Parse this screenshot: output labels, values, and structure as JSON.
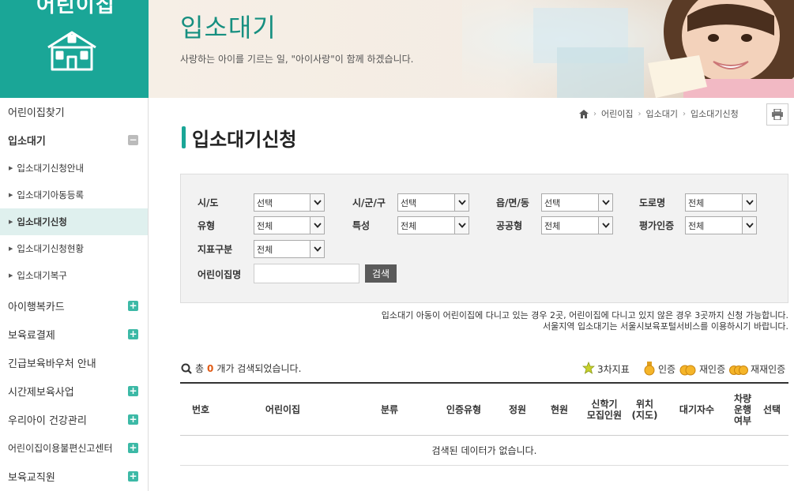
{
  "logo": {
    "text": "어린이집"
  },
  "banner": {
    "title": "입소대기",
    "subtitle": "사랑하는 아이를 기르는 일, \"아이사랑\"이 함께 하겠습니다."
  },
  "sidebar": {
    "items": [
      {
        "label": "어린이집찾기"
      },
      {
        "label": "입소대기"
      },
      {
        "label": "아이행복카드"
      },
      {
        "label": "보육료결제"
      },
      {
        "label": "긴급보육바우처 안내"
      },
      {
        "label": "시간제보육사업"
      },
      {
        "label": "우리아이 건강관리"
      },
      {
        "label": "어린이집이용불편신고센터"
      },
      {
        "label": "보육교직원"
      }
    ],
    "subitems": [
      {
        "label": "입소대기신청안내"
      },
      {
        "label": "입소대기아동등록"
      },
      {
        "label": "입소대기신청"
      },
      {
        "label": "입소대기신청현황"
      },
      {
        "label": "입소대기복구"
      }
    ]
  },
  "breadcrumb": {
    "items": [
      "어린이집",
      "입소대기",
      "입소대기신청"
    ]
  },
  "page": {
    "title": "입소대기신청"
  },
  "filters": {
    "sido_label": "시/도",
    "sido_value": "선택",
    "sigungu_label": "시/군/구",
    "sigungu_value": "선택",
    "eup_label": "읍/면/동",
    "eup_value": "선택",
    "road_label": "도로명",
    "road_value": "전체",
    "type_label": "유형",
    "type_value": "전체",
    "feature_label": "특성",
    "feature_value": "전체",
    "public_label": "공공형",
    "public_value": "전체",
    "eval_label": "평가인증",
    "eval_value": "전체",
    "index_label": "지표구분",
    "index_value": "전체",
    "name_label": "어린이집명",
    "name_value": "",
    "search_button": "검색"
  },
  "notes": {
    "line1": "입소대기 아동이 어린이집에 다니고 있는 경우 2곳, 어린이집에 다니고 있지 않은 경우 3곳까지 신청 가능합니다.",
    "line2": "서울지역 입소대기는 서울시보육포털서비스를 이용하시기 바랍니다."
  },
  "results": {
    "prefix": "총",
    "count": "0",
    "suffix": "개가 검색되었습니다."
  },
  "legend": {
    "third": "3차지표",
    "cert": "인증",
    "recert": "재인증",
    "rerecert": "재재인증"
  },
  "table": {
    "headers": [
      "번호",
      "어린이집",
      "분류",
      "인증유형",
      "정원",
      "현원",
      "신학기\n모집인원",
      "위치\n(지도)",
      "대기자수",
      "차량\n운행\n여부",
      "선택"
    ],
    "empty_message": "검색된 데이터가 없습니다."
  },
  "colors": {
    "brand": "#1aa697",
    "accent": "#e05a14"
  }
}
